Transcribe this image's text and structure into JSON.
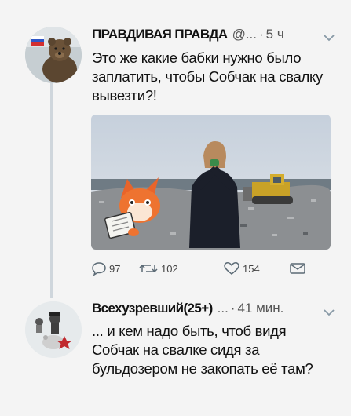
{
  "tweets": [
    {
      "author": "ПРАВДИВАЯ ПРАВДА",
      "handle": "@...",
      "separator": "·",
      "time": "5 ч",
      "text": "Это же какие бабки нужно было заплатить, чтобы Собчак на свалку вывезти?!",
      "avatar_icon": "bear-avatar-icon",
      "stats": {
        "replies": "97",
        "retweets": "102",
        "likes": "154"
      }
    },
    {
      "author": "Всехузревший(25+)",
      "handle": "...",
      "separator": "·",
      "time": "41 мин.",
      "text": "... и кем надо быть, чтоб видя Собчак на свалке сидя за бульдозером не закопать её там?",
      "avatar_icon": "cartoon-avatar-icon"
    }
  ],
  "icons": {
    "reply": "speech-bubble-icon",
    "retweet": "retweet-arrows-icon",
    "like": "heart-icon",
    "dm": "envelope-icon",
    "more": "chevron-down-icon"
  },
  "colors": {
    "thread_line": "#cfd6dc",
    "muted_text": "#555555",
    "icon_stroke": "#5b6a75"
  }
}
